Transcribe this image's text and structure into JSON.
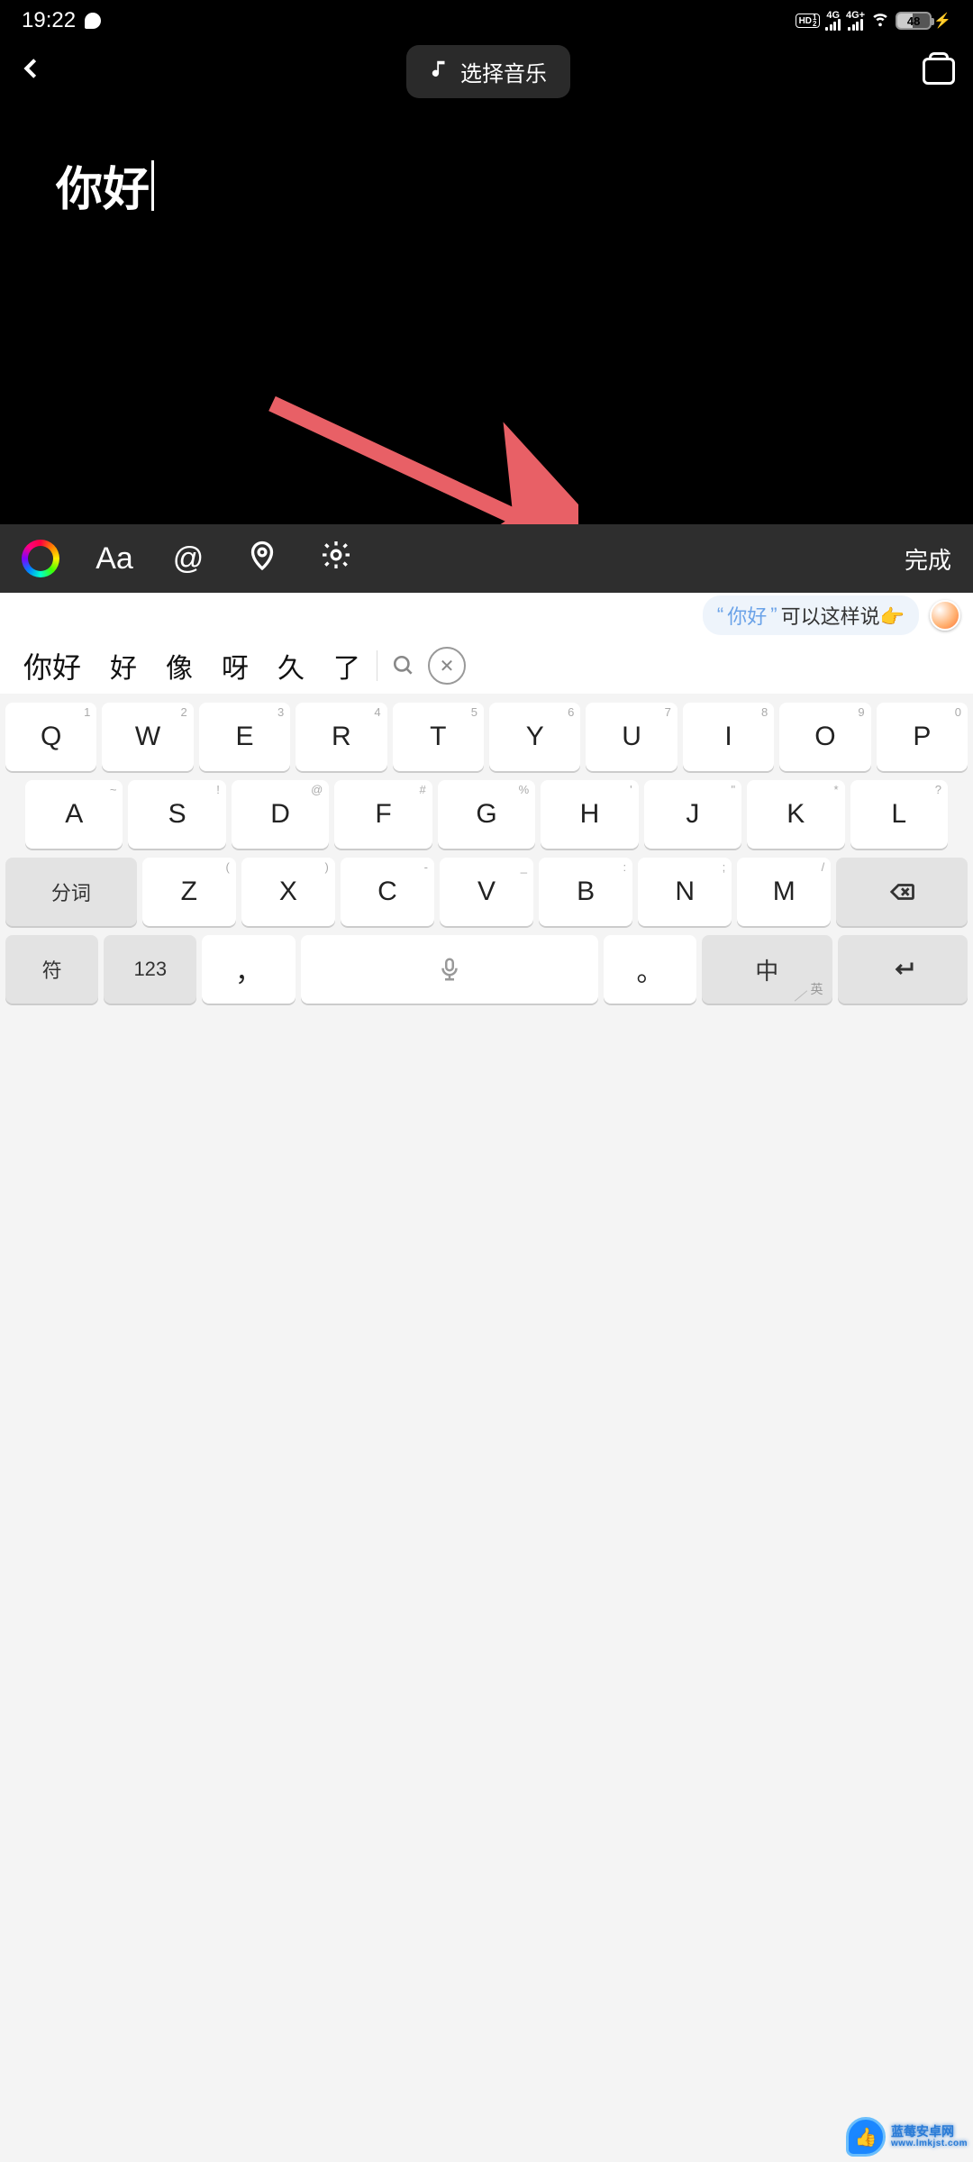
{
  "status": {
    "time": "19:22",
    "hd_label": "HD",
    "hd_sub1": "1",
    "hd_sub2": "2",
    "sig1": "4G",
    "sig2": "4G+",
    "battery": "48",
    "bolt": "⚡"
  },
  "top": {
    "back": "‹",
    "music_label": "选择音乐"
  },
  "canvas": {
    "text": "你好"
  },
  "toolbar": {
    "font": "Aa",
    "at": "@",
    "done": "完成"
  },
  "suggest": {
    "quote_open": "“",
    "quote_word": "你好",
    "quote_close": "”",
    "tail": "可以这样说👉"
  },
  "candidates": [
    "你好",
    "好",
    "像",
    "呀",
    "久",
    "了"
  ],
  "keys": {
    "row1": [
      {
        "m": "Q",
        "h": "1"
      },
      {
        "m": "W",
        "h": "2"
      },
      {
        "m": "E",
        "h": "3"
      },
      {
        "m": "R",
        "h": "4"
      },
      {
        "m": "T",
        "h": "5"
      },
      {
        "m": "Y",
        "h": "6"
      },
      {
        "m": "U",
        "h": "7"
      },
      {
        "m": "I",
        "h": "8"
      },
      {
        "m": "O",
        "h": "9"
      },
      {
        "m": "P",
        "h": "0"
      }
    ],
    "row2": [
      {
        "m": "A",
        "h": "~"
      },
      {
        "m": "S",
        "h": "!"
      },
      {
        "m": "D",
        "h": "@"
      },
      {
        "m": "F",
        "h": "#"
      },
      {
        "m": "G",
        "h": "%"
      },
      {
        "m": "H",
        "h": "'"
      },
      {
        "m": "J",
        "h": "\""
      },
      {
        "m": "K",
        "h": "*"
      },
      {
        "m": "L",
        "h": "?"
      }
    ],
    "row3": [
      {
        "m": "Z",
        "h": "("
      },
      {
        "m": "X",
        "h": ")"
      },
      {
        "m": "C",
        "h": "-"
      },
      {
        "m": "V",
        "h": "_"
      },
      {
        "m": "B",
        "h": ":"
      },
      {
        "m": "N",
        "h": ";"
      },
      {
        "m": "M",
        "h": "/"
      }
    ],
    "fn_split": "分词",
    "fn_sym": "符",
    "fn_num": "123",
    "comma": "，",
    "period": "。",
    "lang_main": "中",
    "lang_sub": "英"
  },
  "watermark": {
    "line1": "蓝莓安卓网",
    "line2": "www.lmkjst.com"
  }
}
